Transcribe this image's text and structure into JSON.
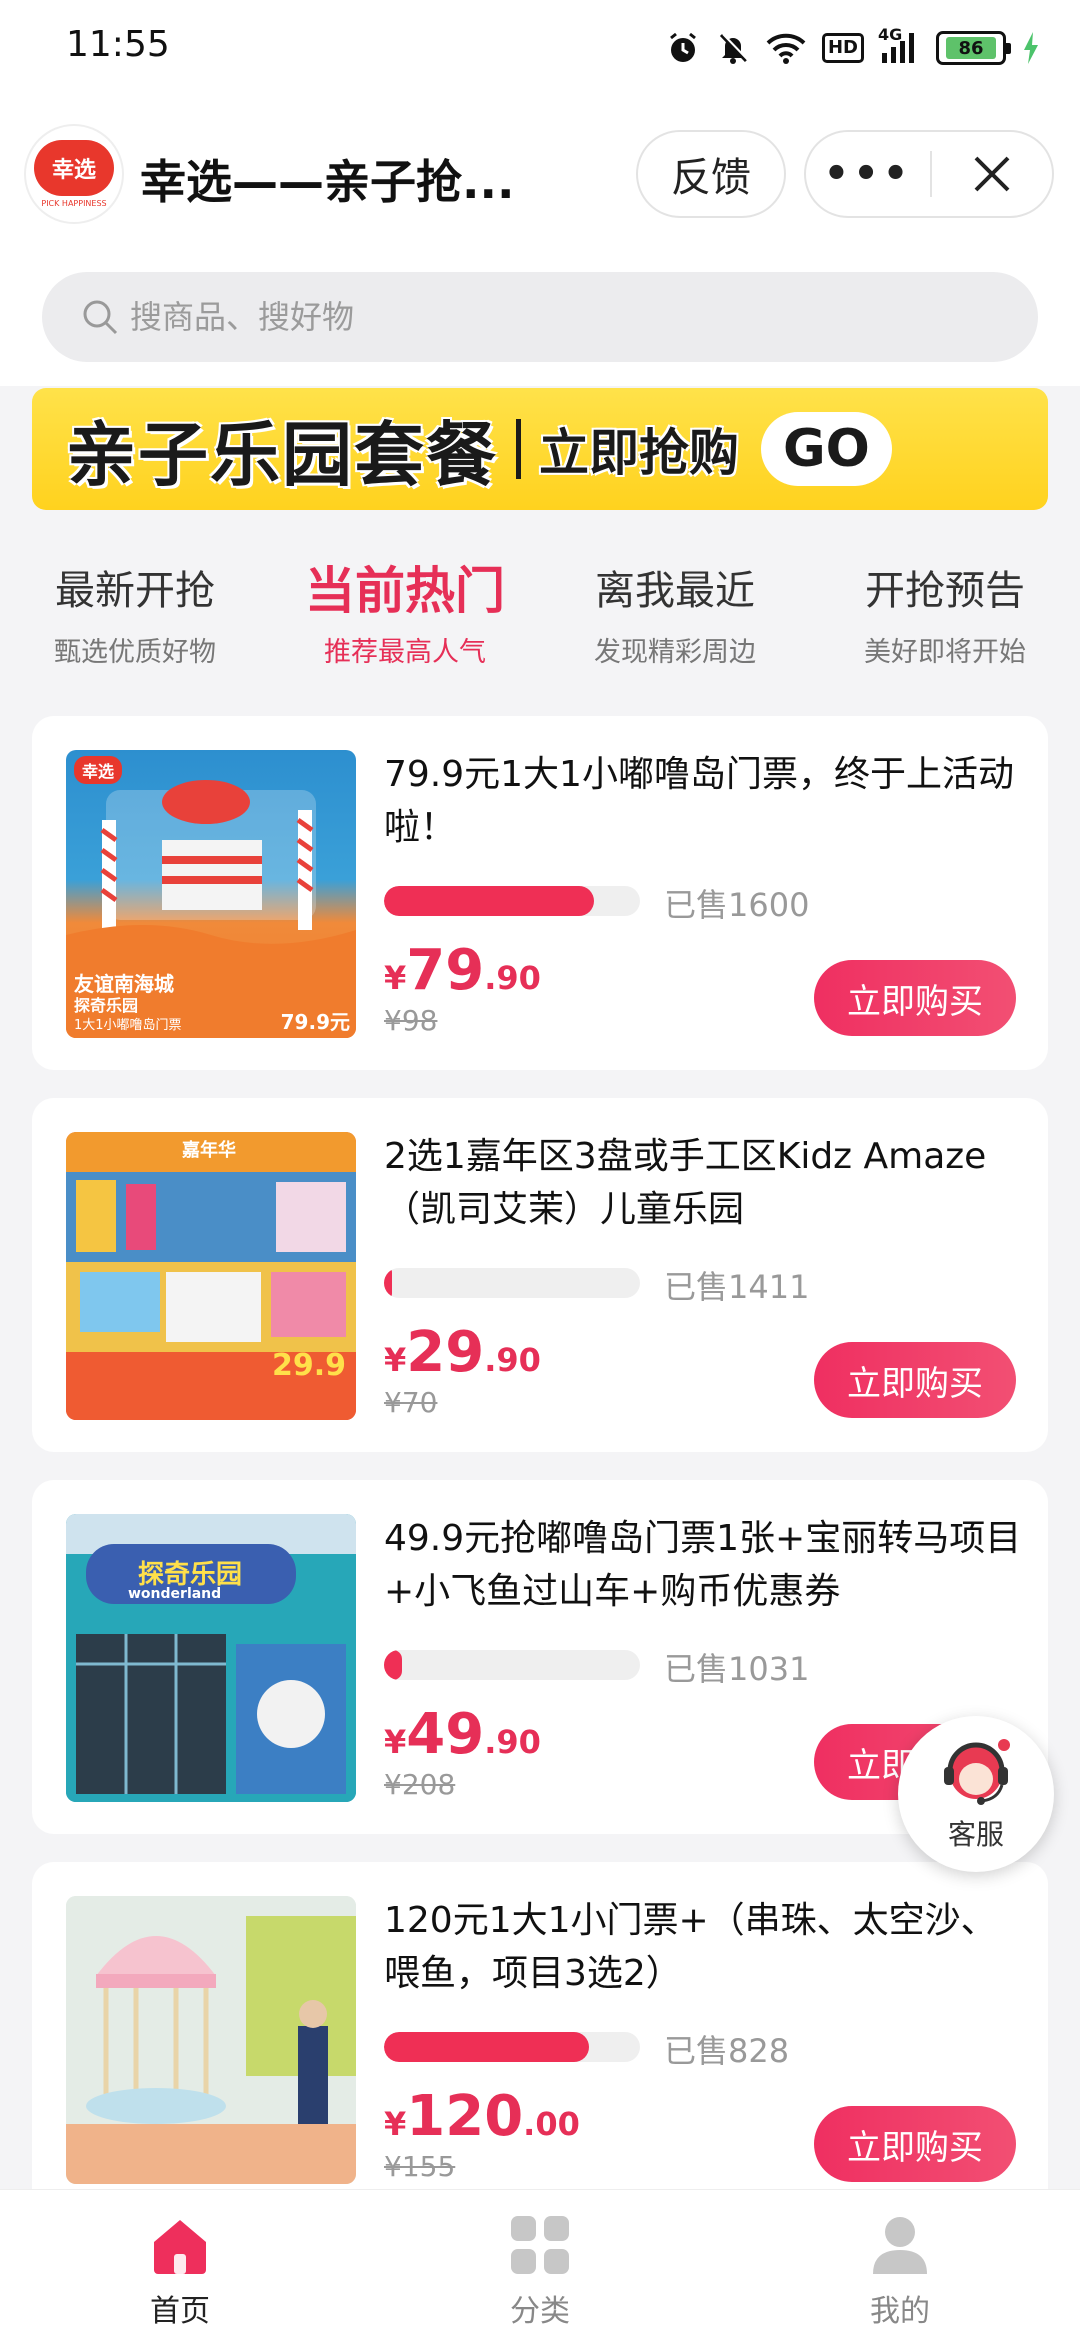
{
  "status_bar": {
    "time": "11:55",
    "hd": "HD",
    "network": "4G",
    "battery": "86"
  },
  "header": {
    "logo_text": "幸选",
    "logo_sub": "PICK HAPPINESS",
    "title": "幸选——亲子抢...",
    "feedback_label": "反馈",
    "more_label": "•••"
  },
  "search": {
    "placeholder": "搜商品、搜好物"
  },
  "banner": {
    "main": "亲子乐园套餐",
    "cta": "立即抢购",
    "go": "GO"
  },
  "tabs": [
    {
      "title": "最新开抢",
      "sub": "甄选优质好物"
    },
    {
      "title": "当前热门",
      "sub": "推荐最高人气"
    },
    {
      "title": "离我最近",
      "sub": "发现精彩周边"
    },
    {
      "title": "开抢预告",
      "sub": "美好即将开始"
    }
  ],
  "active_tab": 1,
  "products": [
    {
      "title": "79.9元1大1小嘟噜岛门票，终于上活动啦！",
      "sold": "已售1600",
      "sold_fraction": 0.82,
      "price_symbol": "¥",
      "price_int": "79",
      "price_dec": ".90",
      "original_price": "¥98",
      "buy_label": "立即购买",
      "thumb": {
        "tag": "幸选",
        "line1": "友谊南海城",
        "line2": "探奇乐园",
        "line3": "1大1小嘟噜岛门票",
        "price": "79.9元"
      }
    },
    {
      "title": "2选1嘉年区3盘或手工区Kidz Amaze（凯司艾茉）儿童乐园",
      "sold": "已售1411",
      "sold_fraction": 0.03,
      "price_symbol": "¥",
      "price_int": "29",
      "price_dec": ".90",
      "original_price": "¥70",
      "buy_label": "立即购买",
      "thumb": {
        "tag": "嘉年华",
        "price": "29.9"
      }
    },
    {
      "title": "49.9元抢嘟噜岛门票1张+宝丽转马项目+小飞鱼过山车+购币优惠券",
      "sold": "已售1031",
      "sold_fraction": 0.07,
      "price_symbol": "¥",
      "price_int": "49",
      "price_dec": ".90",
      "original_price": "¥208",
      "buy_label": "立即购买",
      "thumb": {
        "sign": "探奇乐园",
        "sign_sub": "wonderland"
      }
    },
    {
      "title": "120元1大1小门票+（串珠、太空沙、喂鱼，项目3选2）",
      "sold": "已售828",
      "sold_fraction": 0.8,
      "price_symbol": "¥",
      "price_int": "120",
      "price_dec": ".00",
      "original_price": "¥155",
      "buy_label": "立即购买",
      "thumb": {}
    }
  ],
  "customer_service": {
    "label": "客服"
  },
  "bottom_nav": [
    {
      "label": "首页",
      "icon": "home-icon"
    },
    {
      "label": "分类",
      "icon": "category-icon"
    },
    {
      "label": "我的",
      "icon": "profile-icon"
    }
  ],
  "colors": {
    "accent": "#e62f57",
    "banner": "#ffd21e",
    "progress": "#ef2f55"
  }
}
